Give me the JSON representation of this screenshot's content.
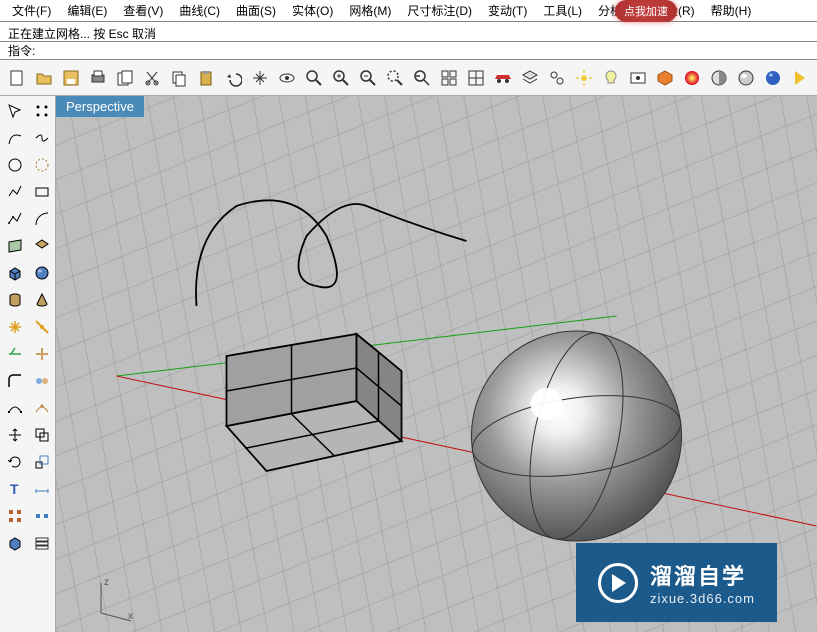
{
  "menu": {
    "file": "文件(F)",
    "edit": "编辑(E)",
    "view": "查看(V)",
    "curve": "曲线(C)",
    "surface": "曲面(S)",
    "solid": "实体(O)",
    "mesh": "网格(M)",
    "dimension": "尺寸标注(D)",
    "transform": "变动(T)",
    "tools": "工具(L)",
    "analyze": "分析(A)",
    "render": "渲染(R)",
    "help": "帮助(H)"
  },
  "overlay": {
    "badge": "点我加速"
  },
  "status": {
    "message": "正在建立网格... 按 Esc 取消"
  },
  "command": {
    "prompt": "指令:"
  },
  "viewport": {
    "label": "Perspective"
  },
  "axes": {
    "z": "z",
    "x": "x"
  },
  "watermark": {
    "cn": "溜溜自学",
    "url": "zixue.3d66.com"
  },
  "toolbar_icons": [
    "new",
    "open",
    "save",
    "print",
    "copy-props",
    "cut",
    "copy",
    "paste",
    "undo",
    "pan",
    "rotate-view",
    "zoom",
    "zoom-extents",
    "zoom-window",
    "zoom-selected",
    "zoom-prev",
    "zoom-all",
    "grid",
    "car",
    "layer",
    "groups",
    "sun-settings",
    "light",
    "named-view",
    "material",
    "render",
    "shade-flat",
    "shade",
    "render2",
    "arrow"
  ],
  "side_icons": [
    "select",
    "lasso",
    "curve1",
    "curve2",
    "circle",
    "circle2",
    "polyline",
    "rect",
    "ctrl-poly",
    "arc",
    "surface",
    "polysurf",
    "box",
    "sphere",
    "cylinder",
    "cone",
    "explode",
    "join",
    "trim",
    "split",
    "fillet",
    "blend",
    "point-edit",
    "point-on",
    "move",
    "copy-tool",
    "rotate",
    "scale",
    "text",
    "dim",
    "array",
    "array2",
    "properties",
    "layers"
  ],
  "colors": {
    "menubar_bg": "#ffffff",
    "viewport_bg": "#bfbfbf",
    "viewport_label_bg": "#4a8ab8",
    "watermark_bg": "#1d5a8c",
    "axis_green": "#12a012",
    "axis_red": "#c01010"
  }
}
